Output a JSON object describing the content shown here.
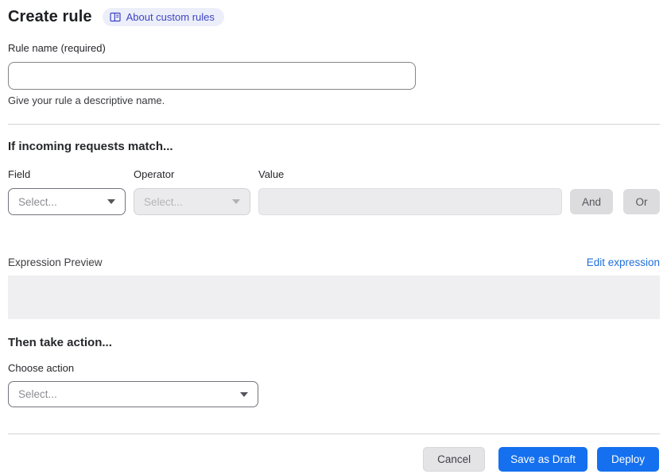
{
  "header": {
    "title": "Create rule",
    "about_badge": {
      "label": "About custom rules",
      "icon": "book-docs-icon"
    }
  },
  "rule_name": {
    "label": "Rule name (required)",
    "value": "",
    "helper": "Give your rule a descriptive name."
  },
  "match": {
    "heading": "If incoming requests match...",
    "field_label": "Field",
    "operator_label": "Operator",
    "value_label": "Value",
    "field_placeholder": "Select...",
    "operator_placeholder": "Select...",
    "value_value": "",
    "and_label": "And",
    "or_label": "Or",
    "expression_preview_label": "Expression Preview",
    "edit_expression_label": "Edit expression",
    "expression_value": ""
  },
  "action": {
    "heading": "Then take action...",
    "choose_label": "Choose action",
    "placeholder": "Select..."
  },
  "footer": {
    "cancel_label": "Cancel",
    "save_draft_label": "Save as Draft",
    "deploy_label": "Deploy"
  },
  "colors": {
    "primary_blue": "#1570ef",
    "link_blue": "#1f6fd8",
    "badge_bg": "#eceefa",
    "badge_text": "#3d46c2",
    "disabled_bg": "#ebebed",
    "chip_gray": "#dcdcdf"
  }
}
